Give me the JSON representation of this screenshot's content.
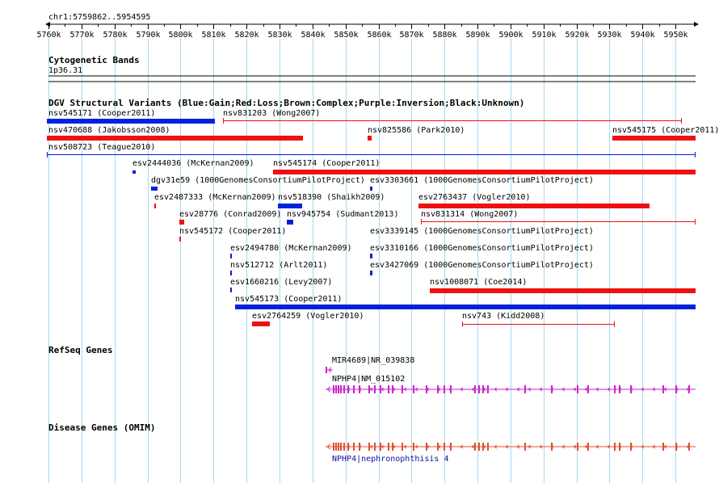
{
  "position": "chr1:5759862..5954595",
  "ruler": {
    "ticks": [
      "5760k",
      "5770k",
      "5780k",
      "5790k",
      "5800k",
      "5810k",
      "5820k",
      "5830k",
      "5840k",
      "5850k",
      "5860k",
      "5870k",
      "5880k",
      "5890k",
      "5900k",
      "5910k",
      "5920k",
      "5930k",
      "5940k",
      "5950k"
    ]
  },
  "cytoband": {
    "title": "Cytogenetic Bands",
    "band": "1p36.31"
  },
  "dgv": {
    "title": "DGV Structural Variants (Blue:Gain;Red:Loss;Brown:Complex;Purple:Inversion;Black:Unknown)",
    "features": [
      {
        "label": "nsv545171 (Cooper2011)",
        "type": "gain",
        "style": "bar"
      },
      {
        "label": "nsv831203 (Wong2007)",
        "type": "loss",
        "style": "span"
      },
      {
        "label": "nsv470688 (Jakobsson2008)",
        "type": "loss",
        "style": "bar"
      },
      {
        "label": "nsv825586 (Park2010)",
        "type": "loss",
        "style": "bar"
      },
      {
        "label": "nsv545175 (Cooper2011)",
        "type": "loss",
        "style": "bar"
      },
      {
        "label": "nsv508723 (Teague2010)",
        "type": "gain",
        "style": "span"
      },
      {
        "label": "esv2444036 (McKernan2009)",
        "type": "gain",
        "style": "bar"
      },
      {
        "label": "nsv545174 (Cooper2011)",
        "type": "loss",
        "style": "bar"
      },
      {
        "label": "dgv31e59 (1000GenomesConsortiumPilotProject)",
        "type": "gain",
        "style": "bar"
      },
      {
        "label": "esv3303661 (1000GenomesConsortiumPilotProject)",
        "type": "gain",
        "style": "bar"
      },
      {
        "label": "esv2487333 (McKernan2009)",
        "type": "loss",
        "style": "bar"
      },
      {
        "label": "nsv518390 (Shaikh2009)",
        "type": "gain",
        "style": "bar"
      },
      {
        "label": "esv2763437 (Vogler2010)",
        "type": "loss",
        "style": "bar"
      },
      {
        "label": "esv28776 (Conrad2009)",
        "type": "loss",
        "style": "bar"
      },
      {
        "label": "nsv945754 (Sudmant2013)",
        "type": "gain",
        "style": "bar"
      },
      {
        "label": "nsv831314 (Wong2007)",
        "type": "loss",
        "style": "span"
      },
      {
        "label": "nsv545172 (Cooper2011)",
        "type": "loss",
        "style": "bar"
      },
      {
        "label": "esv3339145 (1000GenomesConsortiumPilotProject)",
        "type": "gain",
        "style": "bar"
      },
      {
        "label": "esv2494780 (McKernan2009)",
        "type": "gain",
        "style": "bar"
      },
      {
        "label": "esv3310166 (1000GenomesConsortiumPilotProject)",
        "type": "gain",
        "style": "bar"
      },
      {
        "label": "nsv512712 (Arlt2011)",
        "type": "gain",
        "style": "bar"
      },
      {
        "label": "esv3427069 (1000GenomesConsortiumPilotProject)",
        "type": "gain",
        "style": "bar"
      },
      {
        "label": "esv1660216 (Levy2007)",
        "type": "gain",
        "style": "bar"
      },
      {
        "label": "nsv1008071 (Coe2014)",
        "type": "loss",
        "style": "bar"
      },
      {
        "label": "nsv545173 (Cooper2011)",
        "type": "gain",
        "style": "bar"
      },
      {
        "label": "esv2764259 (Vogler2010)",
        "type": "loss",
        "style": "bar"
      },
      {
        "label": "nsv743 (Kidd2008)",
        "type": "loss",
        "style": "span"
      }
    ]
  },
  "refseq": {
    "title": "RefSeq Genes",
    "genes": [
      {
        "label": "MIR4689|NR_039838"
      },
      {
        "label": "NPHP4|NM_015102"
      }
    ]
  },
  "omim": {
    "title": "Disease Genes (OMIM)",
    "genes": [
      {
        "label": "NPHP4|nephronophthisis 4"
      }
    ]
  },
  "colors": {
    "gain": "#0022dd",
    "loss": "#ee1111",
    "refseq": "#cc22cc",
    "omim": "#e05030",
    "grid": "#a8d8f0",
    "omim_label": "#1010a0"
  }
}
